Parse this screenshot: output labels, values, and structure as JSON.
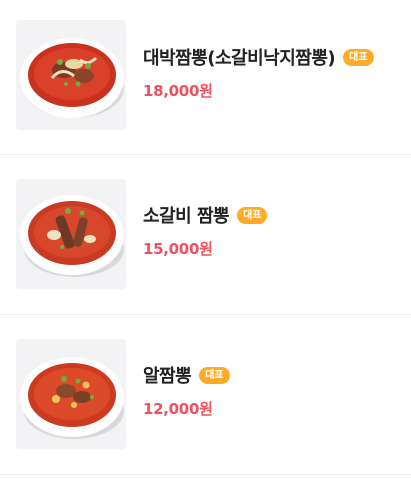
{
  "menu": {
    "items": [
      {
        "name": "대박짬뽕(소갈비낙지짬뽕)",
        "badge": "대표",
        "price": "18,000원",
        "image_icon": "jjamppong-bowl-image"
      },
      {
        "name": "소갈비 짬뽕",
        "badge": "대표",
        "price": "15,000원",
        "image_icon": "jjamppong-bowl-image"
      },
      {
        "name": "알짬뽕",
        "badge": "대표",
        "price": "12,000원",
        "image_icon": "jjamppong-bowl-image"
      }
    ]
  },
  "colors": {
    "price": "#f0515e",
    "badge": "#ffab25",
    "name": "#222222",
    "divider": "#ececec"
  }
}
